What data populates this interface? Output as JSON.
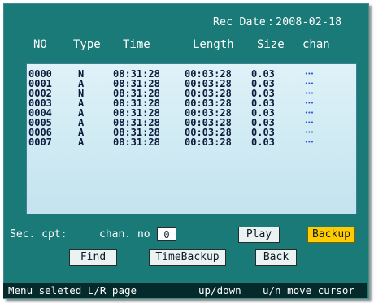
{
  "header": {
    "rec_date_label": "Rec Date",
    "rec_date_sep": ":",
    "rec_date_value": "2008-02-18"
  },
  "columns": {
    "no": "NO",
    "type": "Type",
    "time": "Time",
    "length": "Length",
    "size": "Size",
    "chan": "chan"
  },
  "records": [
    {
      "no": "0000",
      "type": "N",
      "time": "08:31:28",
      "length": "00:03:28",
      "size": "0.03"
    },
    {
      "no": "0001",
      "type": "A",
      "time": "08:31:28",
      "length": "00:03:28",
      "size": "0.03"
    },
    {
      "no": "0002",
      "type": "N",
      "time": "08:31:28",
      "length": "00:03:28",
      "size": "0.03"
    },
    {
      "no": "0003",
      "type": "A",
      "time": "08:31:28",
      "length": "00:03:28",
      "size": "0.03"
    },
    {
      "no": "0004",
      "type": "A",
      "time": "08:31:28",
      "length": "00:03:28",
      "size": "0.03"
    },
    {
      "no": "0005",
      "type": "A",
      "time": "08:31:28",
      "length": "00:03:28",
      "size": "0.03"
    },
    {
      "no": "0006",
      "type": "A",
      "time": "08:31:28",
      "length": "00:03:28",
      "size": "0.03"
    },
    {
      "no": "0007",
      "type": "A",
      "time": "08:31:28",
      "length": "00:03:28",
      "size": "0.03"
    }
  ],
  "controls": {
    "sec_cpt_label": "Sec. cpt:",
    "chan_no_label": "chan. no",
    "chan_no_value": "0",
    "play_button": "Play",
    "backup_button": "Backup",
    "find_button": "Find",
    "time_backup_button": "TimeBackup",
    "back_button": "Back"
  },
  "status_bar": {
    "menu_hint": "Menu seleted L/R page",
    "updown_hint": "up/down",
    "cursor_hint": "u/n move cursor"
  },
  "colors": {
    "panel_bg": "#1a7a78",
    "list_bg": "#cfeaf3",
    "active_button": "#ffcc00",
    "status_bar_bg": "#052a2c",
    "chan_marker": "#2c54d8"
  }
}
